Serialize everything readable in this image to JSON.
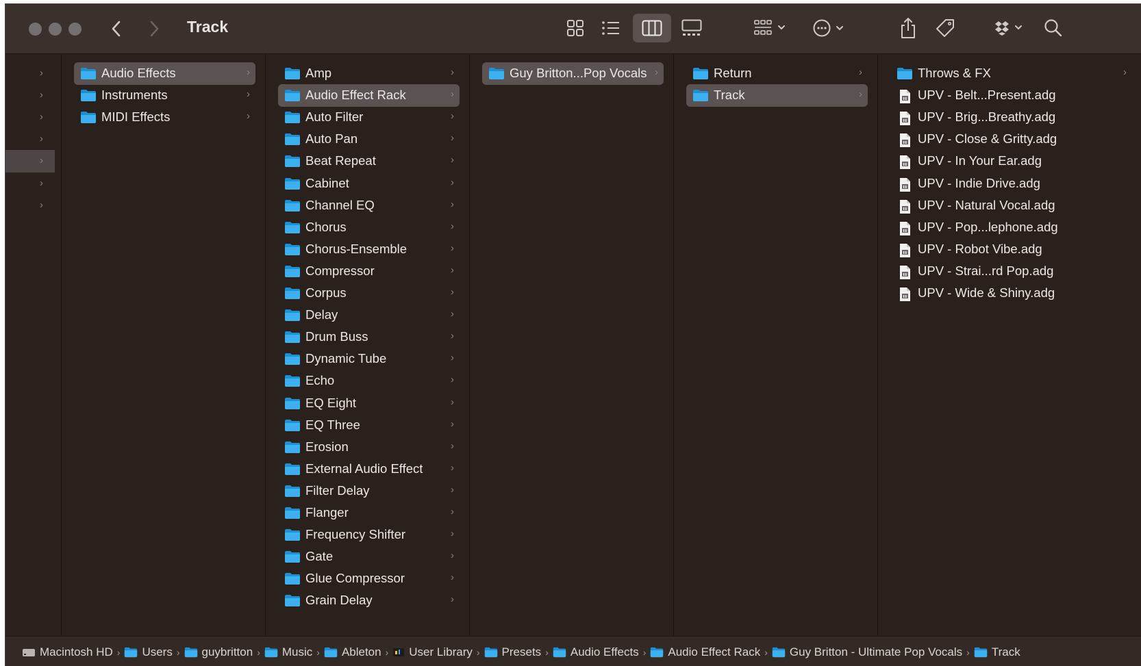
{
  "window": {
    "title": "Track"
  },
  "toolbar": {
    "icons": [
      "icon-view-icon",
      "list-view-icon",
      "column-view-icon",
      "gallery-view-icon",
      "group-icon",
      "more-actions-icon",
      "share-icon",
      "tag-icon",
      "dropbox-icon",
      "search-icon"
    ],
    "active_view": "column-view"
  },
  "columns": {
    "col0": {
      "selected_index": 4,
      "count": 7
    },
    "col1": [
      {
        "label": "Audio Effects",
        "selected": true
      },
      {
        "label": "Instruments"
      },
      {
        "label": "MIDI Effects"
      }
    ],
    "col2": [
      {
        "label": "Amp"
      },
      {
        "label": "Audio Effect Rack",
        "selected": true
      },
      {
        "label": "Auto Filter"
      },
      {
        "label": "Auto Pan"
      },
      {
        "label": "Beat Repeat"
      },
      {
        "label": "Cabinet"
      },
      {
        "label": "Channel EQ"
      },
      {
        "label": "Chorus"
      },
      {
        "label": "Chorus-Ensemble"
      },
      {
        "label": "Compressor"
      },
      {
        "label": "Corpus"
      },
      {
        "label": "Delay"
      },
      {
        "label": "Drum Buss"
      },
      {
        "label": "Dynamic Tube"
      },
      {
        "label": "Echo"
      },
      {
        "label": "EQ Eight"
      },
      {
        "label": "EQ Three"
      },
      {
        "label": "Erosion"
      },
      {
        "label": "External Audio Effect"
      },
      {
        "label": "Filter Delay"
      },
      {
        "label": "Flanger"
      },
      {
        "label": "Frequency Shifter"
      },
      {
        "label": "Gate"
      },
      {
        "label": "Glue Compressor"
      },
      {
        "label": "Grain Delay"
      }
    ],
    "col3": [
      {
        "label": "Guy Britton...Pop Vocals",
        "selected": true
      }
    ],
    "col4": [
      {
        "label": "Return"
      },
      {
        "label": "Track",
        "selected": true
      }
    ],
    "col5": [
      {
        "label": "Throws & FX",
        "type": "folder"
      },
      {
        "label": "UPV - Belt...Present.adg",
        "type": "file"
      },
      {
        "label": "UPV - Brig...Breathy.adg",
        "type": "file"
      },
      {
        "label": "UPV - Close & Gritty.adg",
        "type": "file"
      },
      {
        "label": "UPV - In Your Ear.adg",
        "type": "file"
      },
      {
        "label": "UPV - Indie Drive.adg",
        "type": "file"
      },
      {
        "label": "UPV - Natural Vocal.adg",
        "type": "file"
      },
      {
        "label": "UPV - Pop...lephone.adg",
        "type": "file"
      },
      {
        "label": "UPV - Robot Vibe.adg",
        "type": "file"
      },
      {
        "label": "UPV - Strai...rd Pop.adg",
        "type": "file"
      },
      {
        "label": "UPV - Wide & Shiny.adg",
        "type": "file"
      }
    ]
  },
  "pathbar": [
    {
      "label": "Macintosh HD",
      "icon": "hard-drive-icon"
    },
    {
      "label": "Users",
      "icon": "folder-icon"
    },
    {
      "label": "guybritton",
      "icon": "home-folder-icon"
    },
    {
      "label": "Music",
      "icon": "folder-icon"
    },
    {
      "label": "Ableton",
      "icon": "folder-icon"
    },
    {
      "label": "User Library",
      "icon": "ableton-icon"
    },
    {
      "label": "Presets",
      "icon": "folder-icon"
    },
    {
      "label": "Audio Effects",
      "icon": "folder-icon"
    },
    {
      "label": "Audio Effect Rack",
      "icon": "folder-icon"
    },
    {
      "label": "Guy Britton - Ultimate Pop Vocals",
      "icon": "folder-icon"
    },
    {
      "label": "Track",
      "icon": "folder-icon"
    }
  ],
  "colors": {
    "background": "#2a211d",
    "toolbar": "#3a312d",
    "selection": "#5a5352",
    "folder_blue": "#2aa6e8",
    "text": "#ebe8e6"
  }
}
